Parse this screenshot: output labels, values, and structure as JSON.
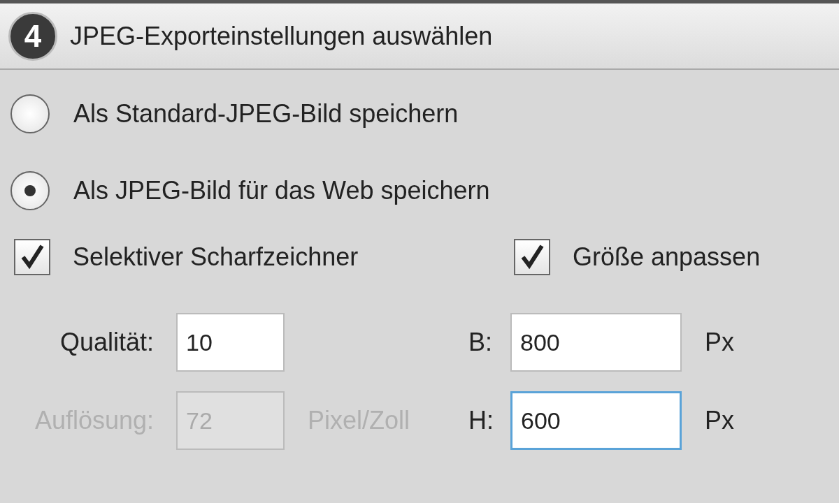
{
  "header": {
    "step": "4",
    "title": "JPEG-Exporteinstellungen auswählen"
  },
  "options": [
    {
      "label": "Als Standard-JPEG-Bild speichern",
      "selected": false
    },
    {
      "label": "Als JPEG-Bild für das Web speichern",
      "selected": true
    }
  ],
  "checkboxes": [
    {
      "label": "Selektiver Scharfzeichner",
      "checked": true
    },
    {
      "label": "Größe anpassen",
      "checked": true
    }
  ],
  "field_rows": [
    {
      "left": {
        "label": "Qualität:",
        "value": "10",
        "disabled": false,
        "focused": false
      },
      "right": {
        "label": "B:",
        "value": "800",
        "unit": "Px",
        "disabled": false,
        "focused": false
      }
    },
    {
      "left": {
        "label": "Auflösung:",
        "value": "72",
        "unit": "Pixel/Zoll",
        "disabled": true,
        "focused": false
      },
      "right": {
        "label": "H:",
        "value": "600",
        "unit": "Px",
        "disabled": false,
        "focused": true
      }
    }
  ]
}
